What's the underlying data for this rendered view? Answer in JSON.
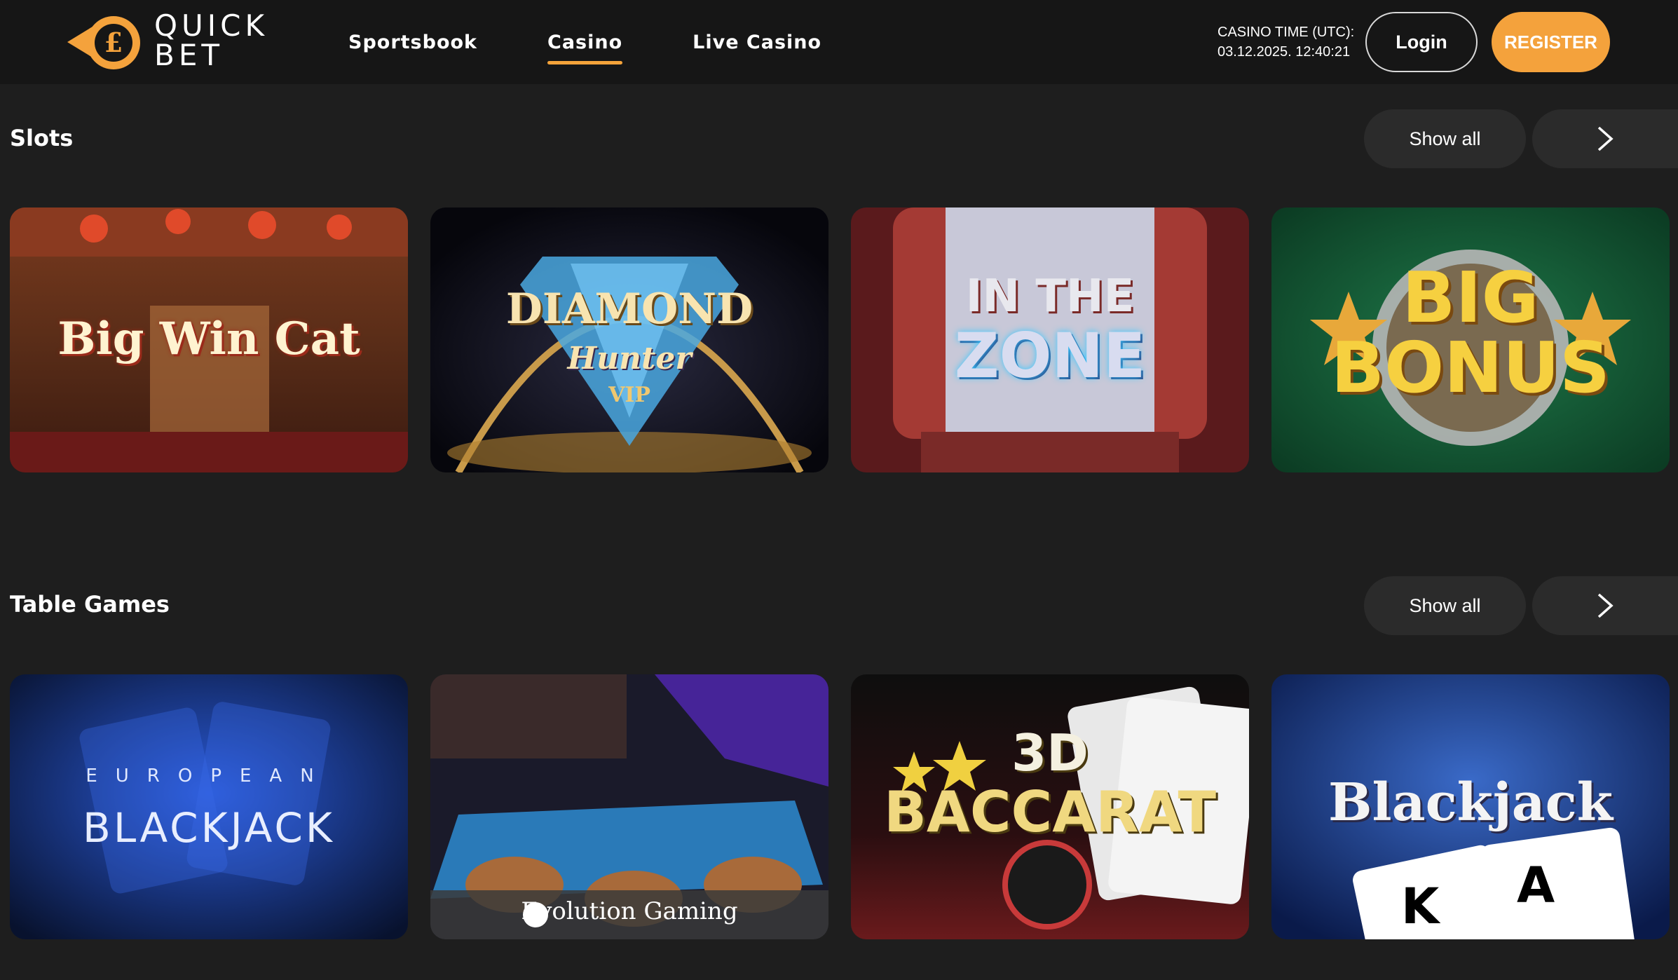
{
  "brand": {
    "line1": "QUICK",
    "line2": "BET"
  },
  "nav": [
    {
      "label": "Sportsbook",
      "active": false
    },
    {
      "label": "Casino",
      "active": true
    },
    {
      "label": "Live Casino",
      "active": false
    }
  ],
  "casino_time": {
    "label": "CASINO TIME (UTC):",
    "value": "03.12.2025. 12:40:21"
  },
  "auth": {
    "login": "Login",
    "register": "REGISTER"
  },
  "sections": [
    {
      "title": "Slots",
      "show_all": "Show all",
      "games": [
        {
          "title": "Big Win Cat"
        },
        {
          "title": "DIAMOND",
          "subtitle": "Hunter",
          "badge": "VIP"
        },
        {
          "title": "IN THE",
          "subtitle": "ZONE"
        },
        {
          "title": "BIG",
          "subtitle": "BONUS"
        }
      ]
    },
    {
      "title": "Table Games",
      "show_all": "Show all",
      "games": [
        {
          "title": "EUROPEAN",
          "subtitle": "BLACKJACK"
        },
        {
          "title": "Evolution Gaming"
        },
        {
          "title": "3D",
          "subtitle": "BACCARAT"
        },
        {
          "title": "Blackjack"
        }
      ]
    }
  ],
  "colors": {
    "accent": "#f4a23c",
    "background": "#1e1e1e",
    "header": "#161616",
    "button": "#2b2b2b"
  }
}
